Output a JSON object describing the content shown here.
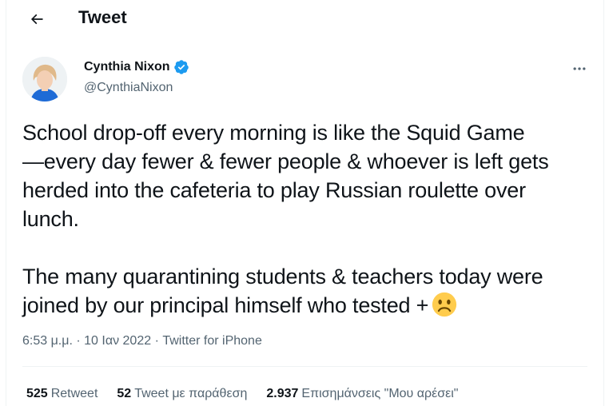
{
  "header": {
    "title": "Tweet",
    "back_icon": "arrow-left-icon"
  },
  "author": {
    "name": "Cynthia Nixon",
    "handle": "@CynthiaNixon",
    "verified_color": "#1d9bf0"
  },
  "tweet": {
    "lines_p1": [
      "School drop-off every morning is like the Squid Game",
      "—every day fewer & fewer people & whoever is left gets",
      "herded into the cafeteria to play Russian roulette over",
      "lunch."
    ],
    "lines_p2": [
      "The many quarantining students & teachers today were",
      "joined by our principal himself who tested +"
    ],
    "emoji": "frowning-face-icon"
  },
  "meta": {
    "time": "6:53 μ.μ.",
    "separator1": " · ",
    "date": "10 Ιαν 2022",
    "separator2": " · ",
    "source": "Twitter for iPhone"
  },
  "stats": {
    "retweets_count": "525",
    "retweets_label": "Retweet",
    "quotes_count": "52",
    "quotes_label": "Tweet με παράθεση",
    "likes_count": "2.937",
    "likes_label": "Επισημάνσεις \"Μου αρέσει\""
  }
}
